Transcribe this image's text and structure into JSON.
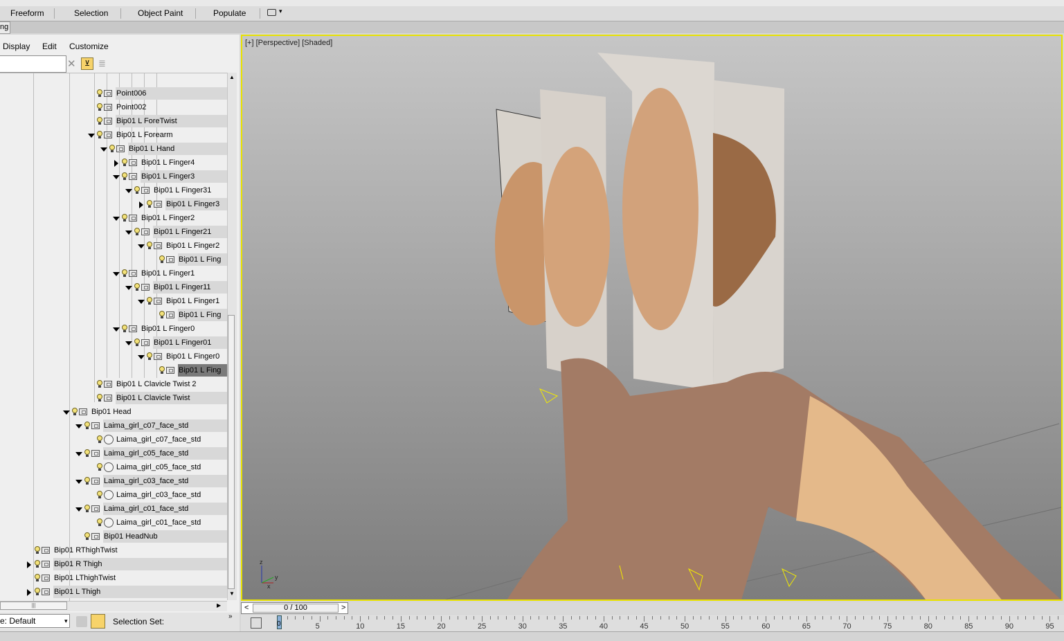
{
  "ribbon": {
    "tabs": [
      "Freeform",
      "Selection",
      "Object Paint",
      "Populate"
    ],
    "mode_tab_label": "ng"
  },
  "explorer": {
    "menu": [
      "Display",
      "Edit",
      "Customize"
    ],
    "search_value": "",
    "rows": [
      {
        "label": "Point006",
        "expand": "none",
        "icon": "object",
        "bg": true,
        "selected": false
      },
      {
        "label": "Point002",
        "expand": "none",
        "icon": "object",
        "bg": false,
        "selected": false
      },
      {
        "label": "Bip01 L ForeTwist",
        "expand": "none",
        "icon": "object",
        "bg": true,
        "selected": false
      },
      {
        "label": "Bip01 L Forearm",
        "expand": "open",
        "icon": "object",
        "bg": false,
        "selected": false
      },
      {
        "label": "Bip01 L Hand",
        "expand": "open",
        "icon": "object",
        "bg": true,
        "selected": false
      },
      {
        "label": "Bip01 L Finger4",
        "expand": "closed",
        "icon": "object",
        "bg": false,
        "selected": false
      },
      {
        "label": "Bip01 L Finger3",
        "expand": "open",
        "icon": "object",
        "bg": true,
        "selected": false
      },
      {
        "label": "Bip01 L Finger31",
        "expand": "open",
        "icon": "object",
        "bg": false,
        "selected": false
      },
      {
        "label": "Bip01 L Finger3",
        "expand": "closed",
        "icon": "object",
        "bg": true,
        "selected": false
      },
      {
        "label": "Bip01 L Finger2",
        "expand": "open",
        "icon": "object",
        "bg": false,
        "selected": false
      },
      {
        "label": "Bip01 L Finger21",
        "expand": "open",
        "icon": "object",
        "bg": true,
        "selected": false
      },
      {
        "label": "Bip01 L Finger2",
        "expand": "open",
        "icon": "object",
        "bg": false,
        "selected": false
      },
      {
        "label": "Bip01 L Fing",
        "expand": "none",
        "icon": "object",
        "bg": true,
        "selected": false
      },
      {
        "label": "Bip01 L Finger1",
        "expand": "open",
        "icon": "object",
        "bg": false,
        "selected": false
      },
      {
        "label": "Bip01 L Finger11",
        "expand": "open",
        "icon": "object",
        "bg": true,
        "selected": false
      },
      {
        "label": "Bip01 L Finger1",
        "expand": "open",
        "icon": "object",
        "bg": false,
        "selected": false
      },
      {
        "label": "Bip01 L Fing",
        "expand": "none",
        "icon": "object",
        "bg": true,
        "selected": false
      },
      {
        "label": "Bip01 L Finger0",
        "expand": "open",
        "icon": "object",
        "bg": false,
        "selected": false
      },
      {
        "label": "Bip01 L Finger01",
        "expand": "open",
        "icon": "object",
        "bg": true,
        "selected": false
      },
      {
        "label": "Bip01 L Finger0",
        "expand": "open",
        "icon": "object",
        "bg": false,
        "selected": false
      },
      {
        "label": "Bip01 L Fing",
        "expand": "none",
        "icon": "object",
        "bg": true,
        "selected": true
      },
      {
        "label": "Bip01 L Clavicle Twist 2",
        "expand": "none",
        "icon": "object",
        "bg": false,
        "selected": false
      },
      {
        "label": "Bip01 L Clavicle Twist",
        "expand": "none",
        "icon": "object",
        "bg": true,
        "selected": false
      },
      {
        "label": "Bip01 Head",
        "expand": "open",
        "icon": "object",
        "bg": false,
        "selected": false
      },
      {
        "label": "Laima_girl_c07_face_std",
        "expand": "open",
        "icon": "object",
        "bg": true,
        "selected": false
      },
      {
        "label": "Laima_girl_c07_face_std",
        "expand": "none",
        "icon": "circle",
        "bg": false,
        "selected": false
      },
      {
        "label": "Laima_girl_c05_face_std",
        "expand": "open",
        "icon": "object",
        "bg": true,
        "selected": false
      },
      {
        "label": "Laima_girl_c05_face_std",
        "expand": "none",
        "icon": "circle",
        "bg": false,
        "selected": false
      },
      {
        "label": "Laima_girl_c03_face_std",
        "expand": "open",
        "icon": "object",
        "bg": true,
        "selected": false
      },
      {
        "label": "Laima_girl_c03_face_std",
        "expand": "none",
        "icon": "circle",
        "bg": false,
        "selected": false
      },
      {
        "label": "Laima_girl_c01_face_std",
        "expand": "open",
        "icon": "object",
        "bg": true,
        "selected": false
      },
      {
        "label": "Laima_girl_c01_face_std",
        "expand": "none",
        "icon": "circle",
        "bg": false,
        "selected": false
      },
      {
        "label": "Bip01 HeadNub",
        "expand": "none",
        "icon": "object",
        "bg": true,
        "selected": false
      },
      {
        "label": "Bip01 RThighTwist",
        "expand": "none",
        "icon": "object",
        "bg": false,
        "selected": false
      },
      {
        "label": "Bip01 R Thigh",
        "expand": "closed",
        "icon": "object",
        "bg": true,
        "selected": false
      },
      {
        "label": "Bip01 LThighTwist",
        "expand": "none",
        "icon": "object",
        "bg": false,
        "selected": false
      },
      {
        "label": "Bip01 L Thigh",
        "expand": "closed",
        "icon": "object",
        "bg": true,
        "selected": false
      }
    ],
    "layer_value": "e: Default",
    "selection_set_label": "Selection Set:"
  },
  "viewport": {
    "label": "[+] [Perspective] [Shaded]",
    "axis_z": "z",
    "axis_x": "x",
    "axis_y": "y"
  },
  "timeline": {
    "frame_display": "0 / 100",
    "prev": "<",
    "next": ">",
    "current": "0",
    "ticks": [
      "5",
      "10",
      "15",
      "20",
      "25",
      "30",
      "35",
      "40",
      "45",
      "50",
      "55",
      "60",
      "65",
      "70",
      "75",
      "80",
      "85",
      "90",
      "95"
    ]
  },
  "colors": {
    "viewport_border": "#e8e200",
    "selected_row": "#7a7a7a",
    "filter_button": "#f7d36a"
  }
}
